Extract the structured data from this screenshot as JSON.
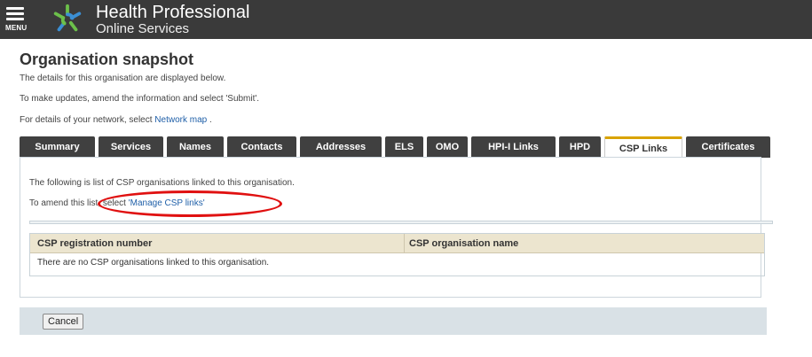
{
  "header": {
    "menu_label": "MENU",
    "brand_title": "Health Professional",
    "brand_subtitle": "Online Services",
    "logo_icon": "star-logo-icon"
  },
  "page": {
    "title": "Organisation snapshot",
    "intro_line1": "The details for this organisation are displayed below.",
    "intro_line2": "To make updates, amend the information and select 'Submit'.",
    "intro_line3_prefix": "For details of your network, select ",
    "network_map_link": "Network map",
    "intro_line3_suffix": " ."
  },
  "tabs": [
    {
      "label": "Summary",
      "active": false
    },
    {
      "label": "Services",
      "active": false
    },
    {
      "label": "Names",
      "active": false
    },
    {
      "label": "Contacts",
      "active": false
    },
    {
      "label": "Addresses",
      "active": false
    },
    {
      "label": "ELS",
      "active": false
    },
    {
      "label": "OMO",
      "active": false
    },
    {
      "label": "HPI-I Links",
      "active": false
    },
    {
      "label": "HPD",
      "active": false
    },
    {
      "label": "CSP Links",
      "active": true
    },
    {
      "label": "Certificates",
      "active": false
    }
  ],
  "panel": {
    "line1": "The following is list of CSP organisations linked to this organisation.",
    "line2_prefix": "To amend this list, select ",
    "manage_link": "'Manage CSP links'",
    "table": {
      "headers": [
        "CSP registration number",
        "CSP organisation name"
      ],
      "empty_message": "There are no CSP organisations linked to this organisation."
    }
  },
  "footer": {
    "cancel_label": "Cancel"
  },
  "colors": {
    "header_bg": "#3a3a3a",
    "tab_bg": "#404040",
    "active_tab_accent": "#d9a300",
    "link": "#1f5fa8",
    "annotation": "#e01010"
  }
}
